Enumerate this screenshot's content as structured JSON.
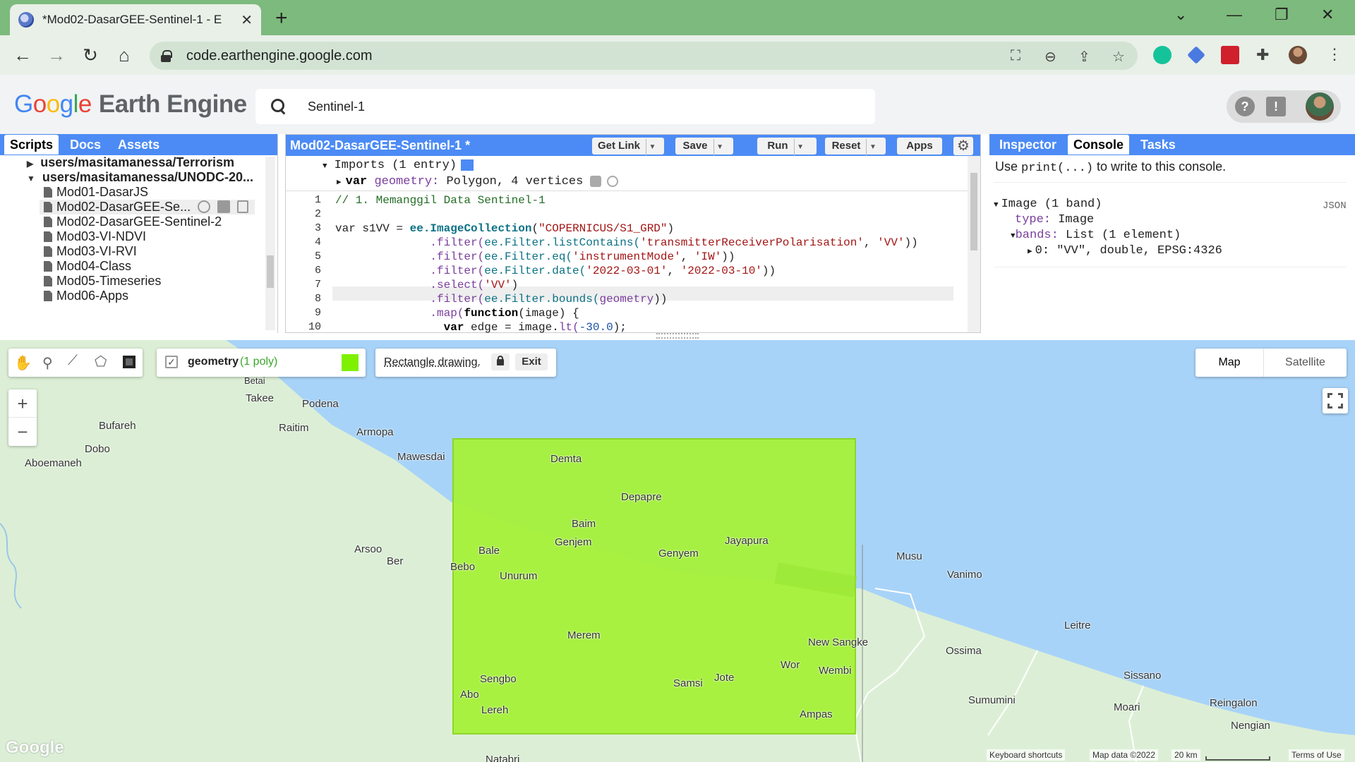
{
  "browser": {
    "tab_title": "*Mod02-DasarGEE-Sentinel-1 - E",
    "url": "code.earthengine.google.com"
  },
  "gee": {
    "logo_google": [
      "G",
      "o",
      "o",
      "g",
      "l",
      "e"
    ],
    "logo_rest": "Earth Engine",
    "search_value": "Sentinel-1"
  },
  "left_panel": {
    "tabs": [
      "Scripts",
      "Docs",
      "Assets"
    ],
    "tree": [
      {
        "type": "folder",
        "label": "users/masitamanessa/Terrorism",
        "expanded": false
      },
      {
        "type": "folder",
        "label": "users/masitamanessa/UNODC-20...",
        "expanded": true
      },
      {
        "type": "file",
        "label": "Mod01-DasarJS"
      },
      {
        "type": "file",
        "label": "Mod02-DasarGEE-Se...",
        "selected": true
      },
      {
        "type": "file",
        "label": "Mod02-DasarGEE-Sentinel-2"
      },
      {
        "type": "file",
        "label": "Mod03-VI-NDVI"
      },
      {
        "type": "file",
        "label": "Mod03-VI-RVI"
      },
      {
        "type": "file",
        "label": "Mod04-Class"
      },
      {
        "type": "file",
        "label": "Mod05-Timeseries"
      },
      {
        "type": "file",
        "label": "Mod06-Apps"
      }
    ]
  },
  "editor": {
    "title": "Mod02-DasarGEE-Sentinel-1 *",
    "buttons": {
      "get_link": "Get Link",
      "save": "Save",
      "run": "Run",
      "reset": "Reset",
      "apps": "Apps"
    },
    "imports_header": "Imports (1 entry)",
    "imports_var": "var",
    "imports_name": "geometry:",
    "imports_desc": "Polygon, 4 vertices",
    "line_numbers": [
      "1",
      "2",
      "3",
      "4",
      "5",
      "6",
      "7",
      "8",
      "9",
      "10"
    ]
  },
  "right_panel": {
    "tabs": [
      "Inspector",
      "Console",
      "Tasks"
    ],
    "hint_before": "Use ",
    "hint_code": "print(...)",
    "hint_after": " to write to this console.",
    "image_header": "Image (1 band)",
    "json_label": "JSON",
    "type_key": "type:",
    "type_val": "Image",
    "bands_key": "bands:",
    "bands_val": "List (1 element)",
    "band0": "0: \"VV\", double, EPSG:4326"
  },
  "map": {
    "geometry_label": "geometry",
    "geometry_count": "(1 poly)",
    "drawing_text": "Rectangle drawing.",
    "exit_label": "Exit",
    "map_type_buttons": [
      "Map",
      "Satellite"
    ],
    "zoom_in": "+",
    "zoom_out": "−",
    "place_labels": [
      "Podena",
      "Bufareh",
      "Raitim",
      "Armopa",
      "Dobo",
      "Aboemaneh",
      "Mawesdai",
      "Demta",
      "Depapre",
      "Baim",
      "Genjem",
      "Bale",
      "Jayapura",
      "Genyem",
      "Arsoo",
      "Ber",
      "Bebo",
      "Unurum",
      "Musu",
      "Vanimo",
      "Leitre",
      "Merem",
      "New Sangke",
      "Ossima",
      "Wor",
      "Wembi",
      "Sissano",
      "Jote",
      "Samsi",
      "Sengbo",
      "Abo",
      "Sumumini",
      "Moari",
      "Reingalon",
      "Lereh",
      "Ampas",
      "Nengian",
      "Natabri",
      "Betai",
      "Takee"
    ],
    "attribution": [
      "Keyboard shortcuts",
      "Map data ©2022",
      "20 km",
      "Terms of Use"
    ],
    "google_watermark": "Google",
    "colors": {
      "water": "#a8d3f8",
      "land": "#dcefd6",
      "rectangle": "#a6f23a",
      "geometry": "#7ff000"
    }
  }
}
